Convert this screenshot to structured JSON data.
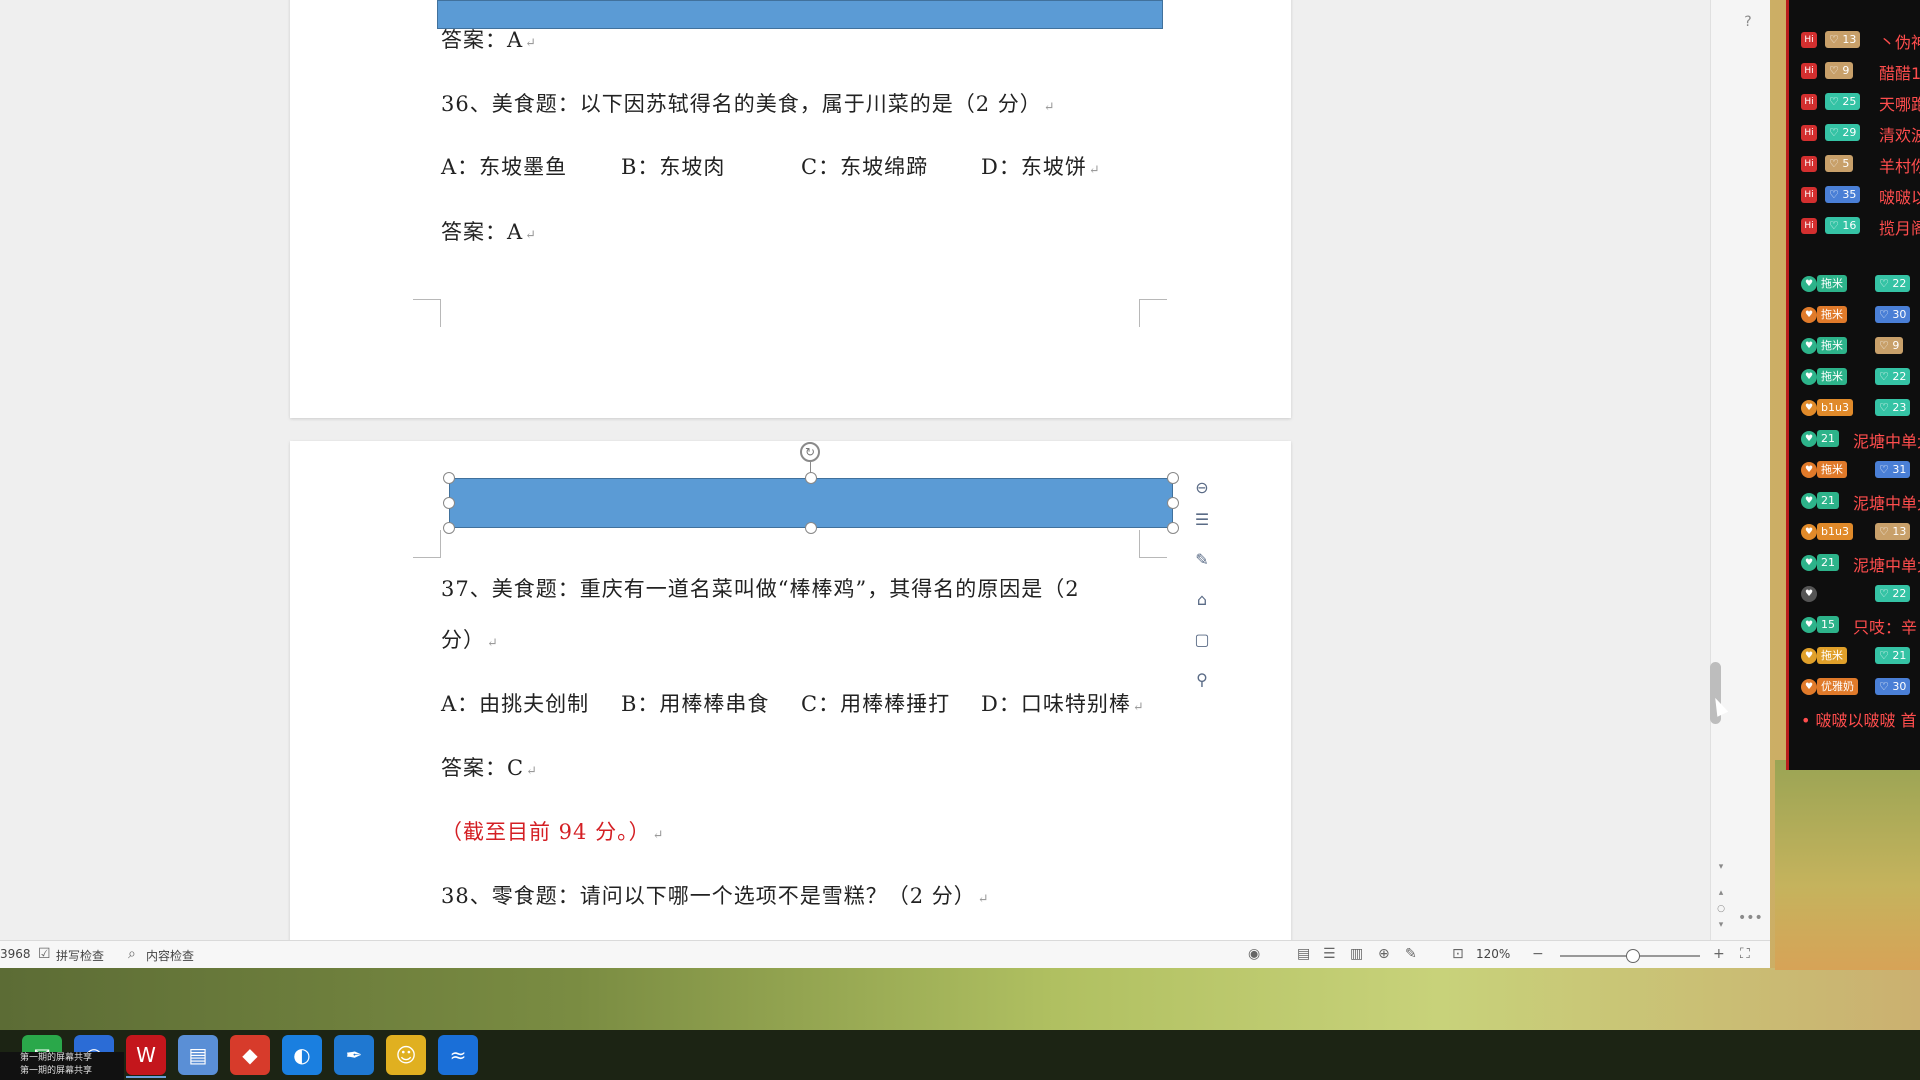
{
  "document": {
    "page1": {
      "answer_prev": "答案：A",
      "q36": "36、美食题：以下因苏轼得名的美食，属于川菜的是（2 分）",
      "q36_options": [
        "A：东坡墨鱼",
        "B：东坡肉",
        "C：东坡绵蹄",
        "D：东坡饼"
      ],
      "q36_answer": "答案：A"
    },
    "page2": {
      "q37_line1": "37、美食题：重庆有一道名菜叫做“棒棒鸡”，其得名的原因是（2",
      "q37_line2": "分）",
      "q37_options": [
        "A：由挑夫创制",
        "B：用棒棒串食",
        "C：用棒棒捶打",
        "D：口味特别棒"
      ],
      "q37_answer": "答案：C",
      "score_note": "（截至目前 94 分。）",
      "q38": "38、零食题：请问以下哪一个选项不是雪糕？（2 分）"
    },
    "paragraph_mark": "↵",
    "shape_color": "#5b9bd5"
  },
  "shape_toolbar": {
    "icons": [
      "collapse-icon",
      "layout-options-icon",
      "outline-pen-icon",
      "fill-icon",
      "border-frame-icon",
      "bulb-icon"
    ]
  },
  "status_bar": {
    "word_count": "3968",
    "spell_check": "拼写检查",
    "content_check": "内容检查",
    "zoom": "120%",
    "zoom_level_percent": 120
  },
  "chat": {
    "rows": [
      {
        "level": "Hi",
        "badge": "13",
        "text": "丶伪神",
        "badge_color": "#c8a06a",
        "level_color": "#d32f2f"
      },
      {
        "level": "Hi",
        "badge": "9",
        "text": "醋醋1",
        "badge_color": "#c8a06a",
        "level_color": "#d32f2f"
      },
      {
        "level": "Hi",
        "badge": "25",
        "text": "天哪跑",
        "badge_color": "#35c3a5",
        "level_color": "#d32f2f"
      },
      {
        "level": "Hi",
        "badge": "29",
        "text": "清欢波",
        "badge_color": "#35c3a5",
        "level_color": "#d32f2f"
      },
      {
        "level": "Hi",
        "badge": "5",
        "text": "羊村你",
        "badge_color": "#c8a06a",
        "level_color": "#d32f2f"
      },
      {
        "level": "Hi",
        "badge": "35",
        "text": "啵啵以",
        "badge_color": "#4a7fd6",
        "level_color": "#d32f2f"
      },
      {
        "level": "Hi",
        "badge": "16",
        "text": "揽月阁",
        "badge_color": "#35c3a5",
        "level_color": "#d32f2f"
      }
    ],
    "fans": [
      {
        "tag": "拖米",
        "num": "22",
        "tag_color": "#2db38a",
        "num_color": "#35c3a5"
      },
      {
        "tag": "拖米",
        "num": "30",
        "tag_color": "#e07a2a",
        "num_color": "#4a7fd6"
      },
      {
        "tag": "拖米",
        "num": "9",
        "tag_color": "#2db38a",
        "num_color": "#c8a06a"
      },
      {
        "tag": "拖米",
        "num": "22",
        "tag_color": "#2db38a",
        "num_color": "#35c3a5"
      },
      {
        "tag": "b1u3",
        "num": "23",
        "tag_color": "#e08a2a",
        "num_color": "#35c3a5"
      },
      {
        "tag": "21",
        "num": "",
        "text": "泥塘中单大",
        "tag_color": "#2db38a",
        "num_color": ""
      },
      {
        "tag": "拖米",
        "num": "31",
        "tag_color": "#e07a2a",
        "num_color": "#4a7fd6"
      },
      {
        "tag": "21",
        "num": "",
        "text": "泥塘中单大",
        "tag_color": "#2db38a",
        "num_color": ""
      },
      {
        "tag": "b1u3",
        "num": "13",
        "tag_color": "#e08a2a",
        "num_color": "#c8a06a"
      },
      {
        "tag": "21",
        "num": "",
        "text": "泥塘中单大",
        "tag_color": "#2db38a",
        "num_color": ""
      },
      {
        "tag": "",
        "num": "22",
        "tag_color": "#555555",
        "num_color": "#35c3a5"
      },
      {
        "tag": "15",
        "num": "",
        "text": "只吱：辛",
        "tag_color": "#2db38a",
        "num_color": ""
      },
      {
        "tag": "拖米",
        "num": "21",
        "tag_color": "#e0a02a",
        "num_color": "#35c3a5"
      },
      {
        "tag": "优雅奶",
        "num": "30",
        "tag_color": "#e07a2a",
        "num_color": "#4a7fd6"
      }
    ],
    "last_line": "啵啵以啵啵 首"
  },
  "taskbar": {
    "share_notice": [
      "第一期的屏幕共享",
      "第一期的屏幕共享"
    ]
  }
}
